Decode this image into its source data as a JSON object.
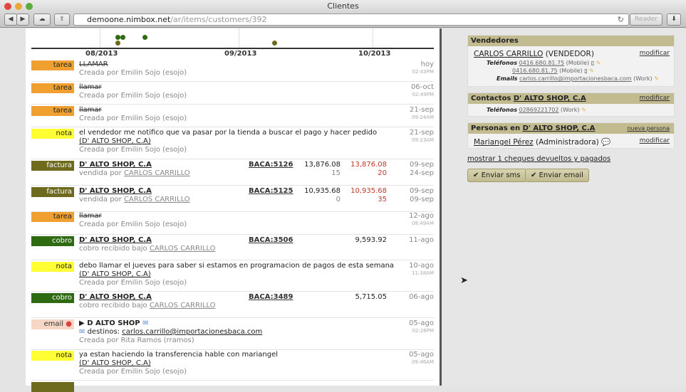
{
  "window": {
    "title": "Clientes",
    "url_host": "demoone.nimbox.net",
    "url_path": "/ar/items/customers/392",
    "reader": "Reader"
  },
  "timeline": {
    "ticks": [
      "08/2013",
      "09/2013",
      "10/2013"
    ]
  },
  "colors": {
    "tarea": "#f0a030",
    "nota": "#ffff33",
    "factura": "#6e6a1e",
    "cobro": "#2e6a12",
    "email": "#f6d7c6"
  },
  "rows": [
    {
      "type": "tarea",
      "title": "LLAMAR",
      "sub": "Creada por Emilin Sojo (esojo)",
      "date": "hoy",
      "time": "02:43PM"
    },
    {
      "type": "tarea",
      "title": "llamar",
      "sub": "Creada por Emilin Sojo (esojo)",
      "date": "06-oct",
      "time": "02:49PM"
    },
    {
      "type": "tarea",
      "title": "llamar",
      "sub": "Creada por Emilin Sojo (esojo)",
      "date": "21-sep",
      "time": "09:24AM"
    },
    {
      "type": "nota",
      "title": "el vendedor me notifico que va pasar por la tienda a buscar el pago y hacer pedido",
      "link": "(D' ALTO SHOP, C.A)",
      "sub": "Creada por Emilin Sojo (esojo)",
      "date": "21-sep",
      "time": "09:23AM"
    },
    {
      "type": "factura",
      "title": "D' ALTO SHOP, C.A",
      "sub_prefix": "vendida por",
      "sub_link": "CARLOS CARRILLO",
      "ref": "BACA:5126",
      "amount": "13,876.08",
      "amount2": "13,876.08",
      "n1": "15",
      "n2": "20",
      "date": "09-sep",
      "date2": "24-sep"
    },
    {
      "type": "factura",
      "title": "D' ALTO SHOP, C.A",
      "sub_prefix": "vendida por",
      "sub_link": "CARLOS CARRILLO",
      "ref": "BACA:5125",
      "amount": "10,935.68",
      "amount2": "10,935.68",
      "n1": "0",
      "n2": "35",
      "date": "09-sep",
      "date2": "09-sep"
    },
    {
      "type": "tarea",
      "title": "llamar",
      "sub": "Creada por Emilin Sojo (esojo)",
      "date": "12-ago",
      "time": "08:49AM"
    },
    {
      "type": "cobro",
      "title": "D' ALTO SHOP, C.A",
      "sub_prefix": "cobro recibido bajo",
      "sub_link": "CARLOS CARRILLO",
      "ref": "BACA:3506",
      "amount": "9,593.92",
      "date": "11-ago"
    },
    {
      "type": "nota",
      "title": "debo llamar el jueves para saber si estamos en programacion de pagos de esta semana",
      "link": "(D' ALTO SHOP, C.A)",
      "sub": "Creada por Emilin Sojo (esojo)",
      "date": "10-ago",
      "time": "11:38AM"
    },
    {
      "type": "cobro",
      "title": "D' ALTO SHOP, C.A",
      "sub_prefix": "cobro recibido bajo",
      "sub_link": "CARLOS CARRILLO",
      "ref": "BACA:3489",
      "amount": "5,715.05",
      "date": "06-ago"
    },
    {
      "type": "email",
      "title": "D ALTO SHOP",
      "dest_label": "destinos:",
      "dest": "carlos.carrillo@importacionesbaca.com",
      "sub": "Creada por Rita Ramos (rramos)",
      "date": "05-ago",
      "time": "02:26PM"
    },
    {
      "type": "nota",
      "title": "ya estan haciendo la transferencia hable con mariangel",
      "link": "(D' ALTO SHOP, C.A)",
      "sub": "Creada por Emilin Sojo (esojo)",
      "date": "05-ago",
      "time": "09:46AM"
    }
  ],
  "vendedores": {
    "header": "Vendedores",
    "name": "CARLOS CARRILLO",
    "role": "(VENDEDOR)",
    "modify": "modificar",
    "phones_label": "Teléfonos",
    "phone1": "0416.680.81.75",
    "phone2": "0416.680.81.75",
    "mobile": "(Mobile)",
    "emails_label": "Emails",
    "email": "carlos.carrillo@importacionesbaca.com",
    "work": "(Work)"
  },
  "contactos": {
    "header": "Contactos",
    "company": "D' ALTO SHOP, C.A",
    "modify": "modificar",
    "phones_label": "Teléfonos",
    "phone": "02869221702",
    "work": "(Work)"
  },
  "personas": {
    "header": "Personas en",
    "company": "D' ALTO SHOP, C.A",
    "new": "nueva persona",
    "name": "Mariangel Pérez",
    "role": "(Administradora)",
    "modify": "modificar"
  },
  "cheques_link": "mostrar 1 cheques devueltos y pagados",
  "buttons": {
    "sms": "Enviar sms",
    "email": "Enviar email"
  }
}
